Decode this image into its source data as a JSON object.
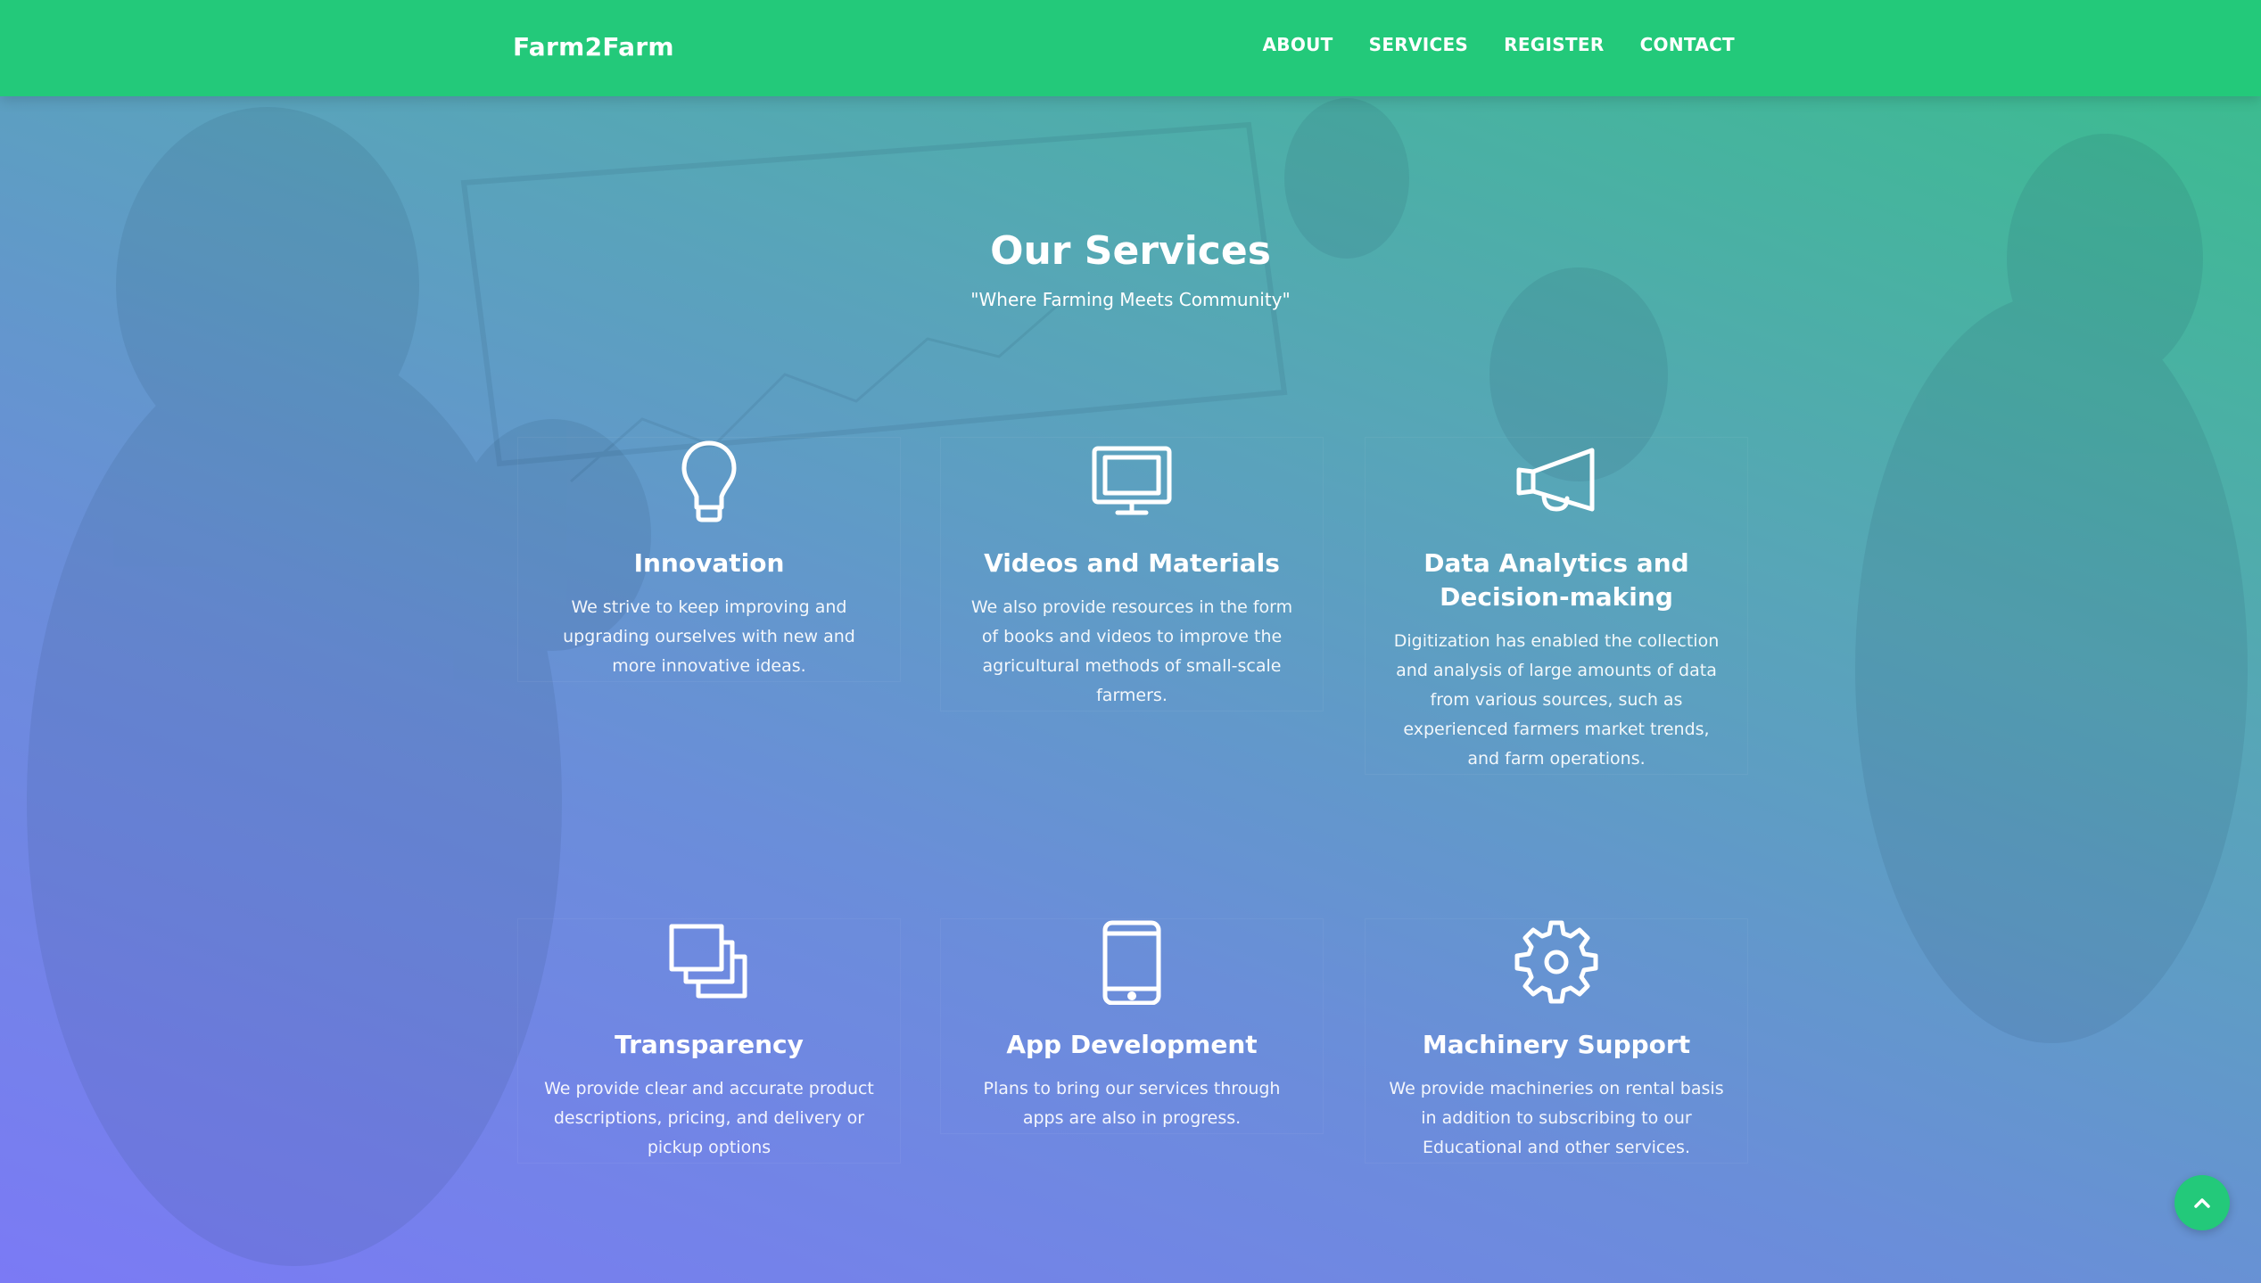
{
  "nav": {
    "brand": "Farm2Farm",
    "links": [
      {
        "label": "ABOUT"
      },
      {
        "label": "SERVICES"
      },
      {
        "label": "REGISTER"
      },
      {
        "label": "CONTACT"
      }
    ]
  },
  "services": {
    "title": "Our Services",
    "subtitle": "\"Where Farming Meets Community\"",
    "items": [
      {
        "icon": "lightbulb-icon",
        "title": "Innovation",
        "description": "We strive to keep improving and upgrading ourselves with new and more innovative ideas."
      },
      {
        "icon": "monitor-icon",
        "title": "Videos and Materials",
        "description": "We also provide resources in the form of books and videos to improve the agricultural methods of small-scale farmers."
      },
      {
        "icon": "megaphone-icon",
        "title": "Data Analytics and Decision-making",
        "description": "Digitization has enabled the collection and analysis of large amounts of data from various sources, such as experienced farmers market trends, and farm operations."
      },
      {
        "icon": "stacked-windows-icon",
        "title": "Transparency",
        "description": "We provide clear and accurate product descriptions, pricing, and delivery or pickup options"
      },
      {
        "icon": "smartphone-icon",
        "title": "App Development",
        "description": "Plans to bring our services through apps are also in progress."
      },
      {
        "icon": "gear-icon",
        "title": "Machinery Support",
        "description": "We provide machineries on rental basis in addition to subscribing to our Educational and other services."
      }
    ]
  },
  "scroll_top": {
    "icon": "chevron-up-icon"
  },
  "colors": {
    "navbar": "#23c97a",
    "gradient_start": "#7b7af5",
    "gradient_end": "#38bf8a",
    "text": "#ffffff"
  }
}
